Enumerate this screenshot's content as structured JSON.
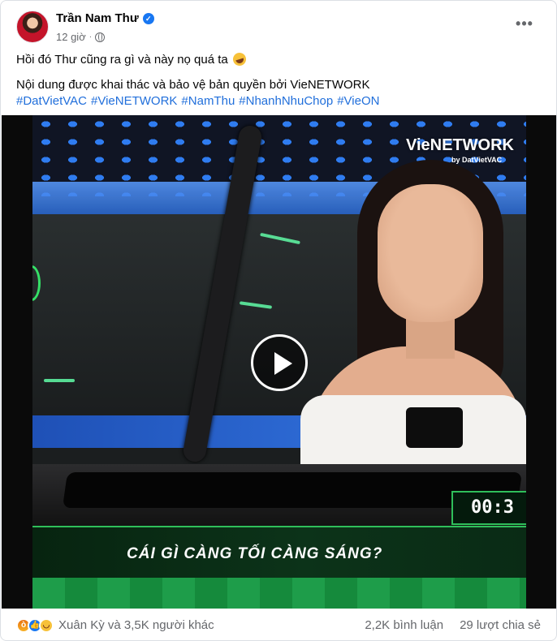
{
  "post": {
    "author": "Trần Nam Thư",
    "time": "12 giờ",
    "line1": "Hồi đó Thư cũng ra gì và này nọ quá ta",
    "line2": "Nội dung được khai thác và bảo vệ bản quyền bởi VieNETWORK",
    "hashtags": [
      "#DatVietVAC",
      "#VieNETWORK",
      "#NamThu",
      "#NhanhNhuChop",
      "#VieON"
    ]
  },
  "video": {
    "watermark": "VieNETWORK",
    "watermark_sub": "by DatVietVAC",
    "timer": "00:3",
    "question": "CÁI GÌ CÀNG TỐI CÀNG SÁNG?"
  },
  "footer": {
    "reaction_icons": [
      "angry-react-icon",
      "like-react-icon",
      "haha-react-icon"
    ],
    "reactions_text": "Xuân Kỳ và 3,5K người khác",
    "comments": "2,2K bình luận",
    "shares": "29 lượt chia sẻ"
  },
  "colors": {
    "link": "#216fdb",
    "secondary_text": "#65676b",
    "verified": "#1877f2",
    "timer_border": "#2fbf5a"
  }
}
